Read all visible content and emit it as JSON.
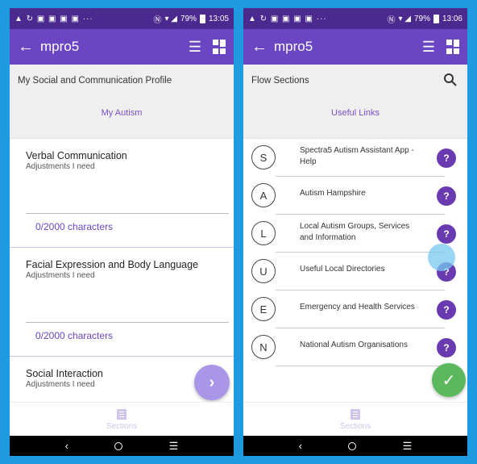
{
  "status_left": {
    "icons": "▲ ↻ ▣ ▣ ▣ ▣  ···",
    "nfc": "Ⓝ",
    "signal": "▾ ◢",
    "battery": "79%",
    "time": "13:05"
  },
  "status_right": {
    "icons": "▲ ↻ ▣ ▣ ▣ ▣  ···",
    "nfc": "Ⓝ",
    "signal": "▾ ◢",
    "battery": "79%",
    "time": "13:06"
  },
  "app": {
    "title": "mpro5",
    "back_glyph": "←",
    "menu_glyph": "☰"
  },
  "left": {
    "subheader_title": "My Social and Communication Profile",
    "subheader_link": "My Autism",
    "items": [
      {
        "title": "Verbal Communication",
        "subtitle": "Adjustments I need",
        "count": "0/2000 characters"
      },
      {
        "title": "Facial Expression and Body Language",
        "subtitle": "Adjustments I need",
        "count": "0/2000 characters"
      },
      {
        "title": "Social Interaction",
        "subtitle": "Adjustments I need"
      }
    ],
    "fab_glyph": "›"
  },
  "right": {
    "subheader_title": "Flow Sections",
    "subheader_link": "Useful Links",
    "links": [
      {
        "letter": "S",
        "text": "Spectra5 Autism Assistant App - Help"
      },
      {
        "letter": "A",
        "text": "Autism Hampshire"
      },
      {
        "letter": "L",
        "text": "Local Autism Groups, Services and Information"
      },
      {
        "letter": "U",
        "text": "Useful Local Directories"
      },
      {
        "letter": "E",
        "text": "Emergency and Health Services"
      },
      {
        "letter": "N",
        "text": "National Autism Organisations"
      }
    ],
    "help_glyph": "?",
    "fab_glyph": "✓"
  },
  "bottom_nav": {
    "label": "Sections"
  },
  "sysnav": {
    "back": "‹",
    "recents": "☰"
  },
  "colors": {
    "status_bar": "#4a2a8f",
    "app_bar": "#6a46c2",
    "accent": "#7b4fc9",
    "help_button": "#6a3ab0",
    "fab_green": "#5cb85c",
    "fab_purple": "#a996e6",
    "background": "#1e9be0"
  }
}
